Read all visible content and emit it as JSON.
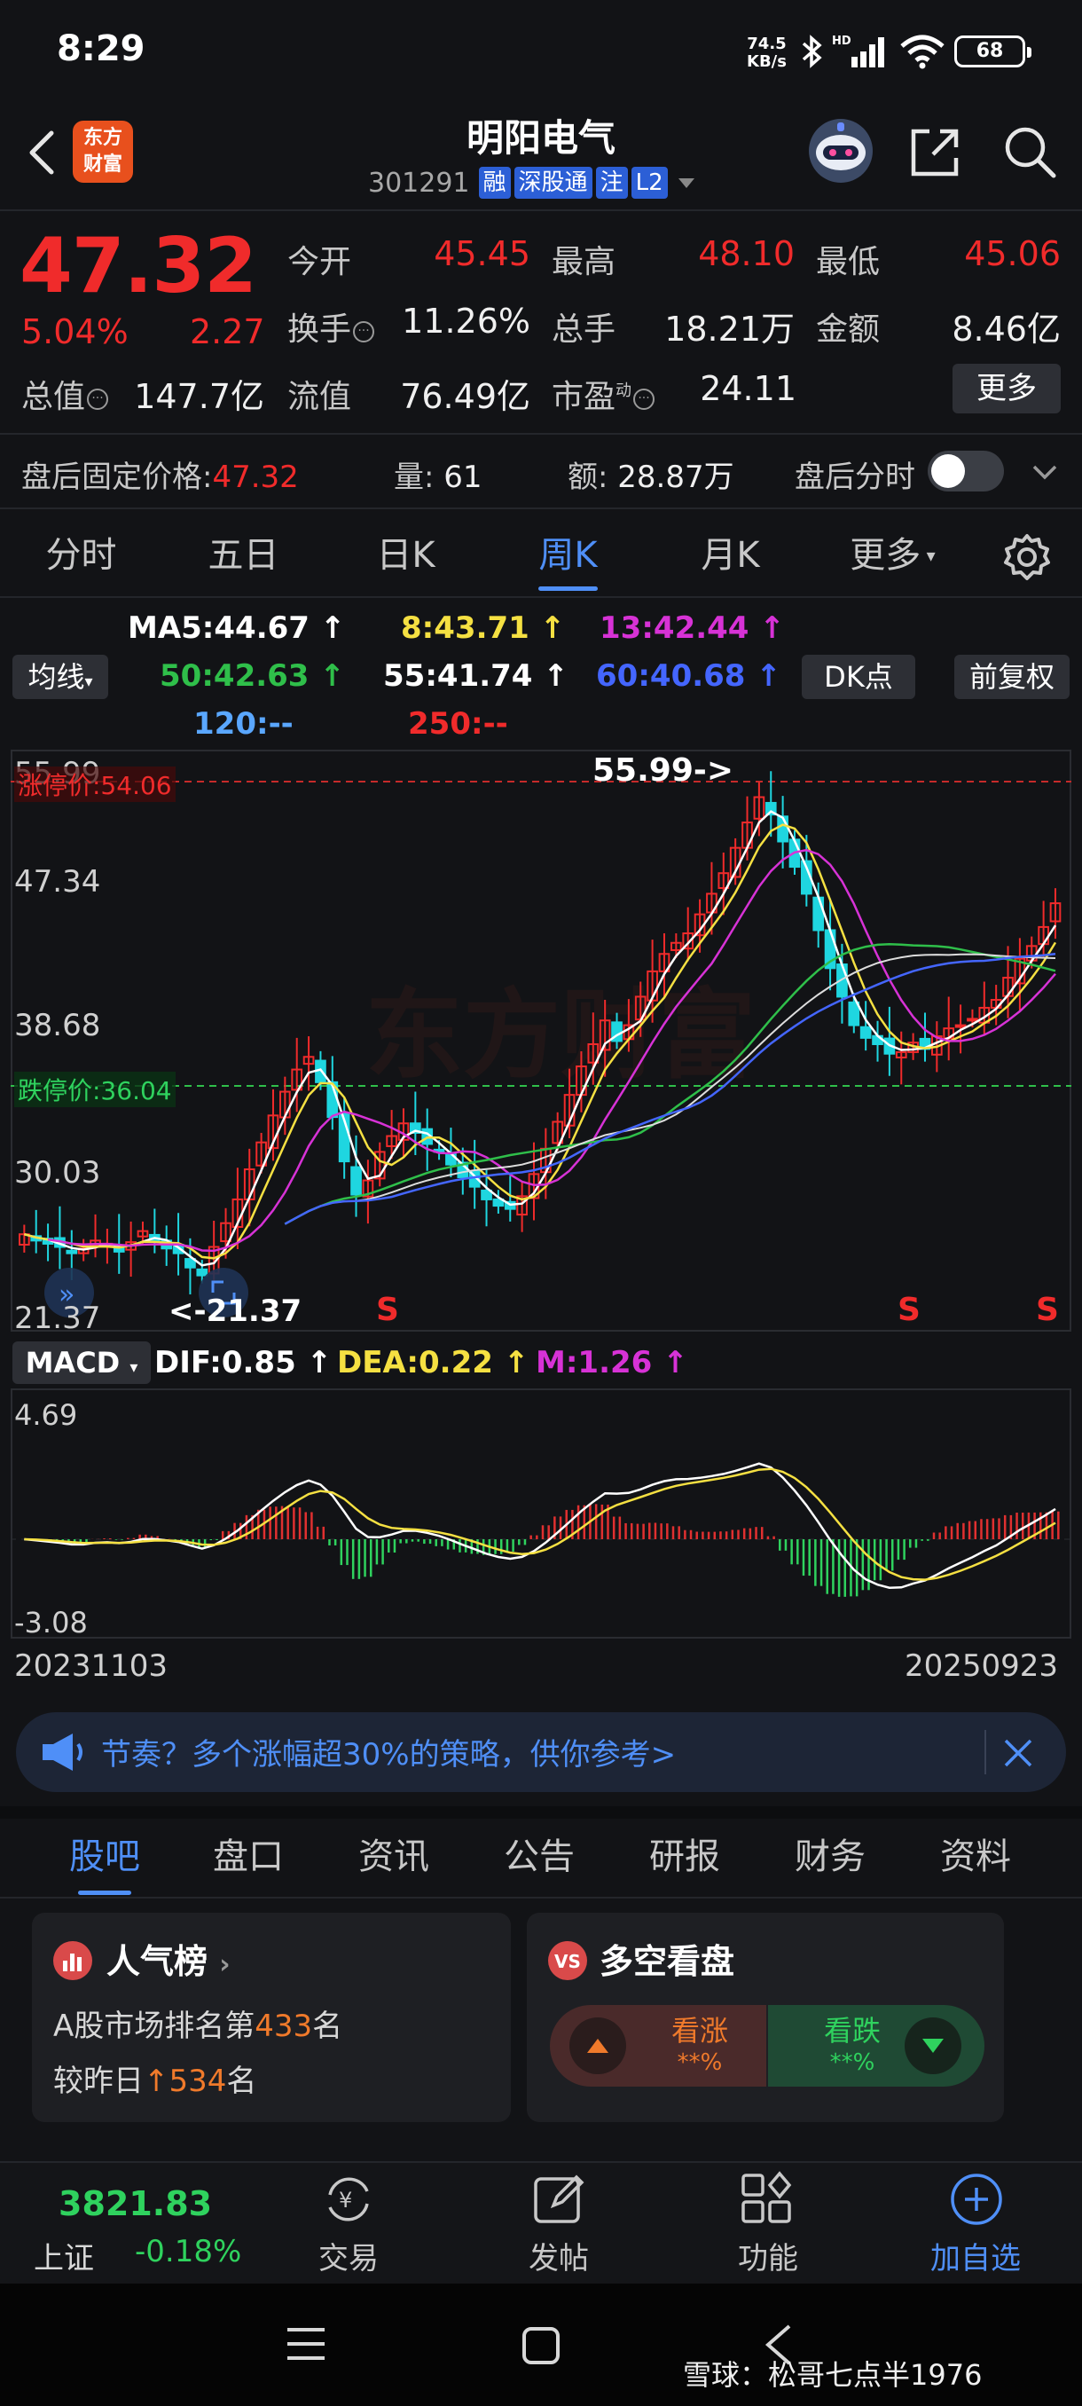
{
  "status": {
    "time": "8:29",
    "net_speed": "74.5",
    "net_unit": "KB/s",
    "battery": "68"
  },
  "header": {
    "logo_line1": "东方",
    "logo_line2": "财富",
    "stock_name": "明阳电气",
    "stock_code": "301291",
    "tags": [
      "融",
      "深股通",
      "注",
      "L2"
    ]
  },
  "quote": {
    "price": "47.32",
    "change_pct": "5.04%",
    "change_amt": "2.27",
    "open_label": "今开",
    "open": "45.45",
    "high_label": "最高",
    "high": "48.10",
    "low_label": "最低",
    "low": "45.06",
    "turnover_label": "换手",
    "turnover": "11.26%",
    "volume_label": "总手",
    "volume": "18.21万",
    "amount_label": "金额",
    "amount": "8.46亿",
    "mktcap_label": "总值",
    "mktcap": "147.7亿",
    "float_label": "流值",
    "float": "76.49亿",
    "pe_label": "市盈",
    "pe_sup": "动",
    "pe": "24.11",
    "more": "更多"
  },
  "afterhours": {
    "price_label": "盘后固定价格:",
    "price": "47.32",
    "vol_label": "量:",
    "vol": "61",
    "amt_label": "额:",
    "amt": "28.87万",
    "toggle_label": "盘后分时"
  },
  "period_tabs": [
    "分时",
    "五日",
    "日K",
    "周K",
    "月K",
    "更多"
  ],
  "ma_legend": {
    "ma5": "MA5:44.67",
    "ma8": "8:43.71",
    "ma13": "13:42.44",
    "ma50": "50:42.63",
    "ma55": "55:41.74",
    "ma60": "60:40.68",
    "ma120": "120:--",
    "ma250": "250:--",
    "avg_btn": "均线",
    "dk_btn": "DK点",
    "fq_btn": "前复权"
  },
  "chart_data": {
    "type": "candlestick",
    "y_ticks": [
      "55.99",
      "47.34",
      "38.68",
      "30.03",
      "21.37"
    ],
    "limit_up_label": "涨停价:54.06",
    "limit_down_label": "跌停价:36.04",
    "max_label": "55.99->",
    "min_label": "<-21.37",
    "sell_marks": [
      "S",
      "S",
      "S"
    ],
    "ylim": [
      21.37,
      55.99
    ],
    "closes": [
      26.4,
      26.0,
      25.8,
      25.6,
      25.2,
      25.5,
      26.0,
      25.8,
      25.3,
      25.9,
      26.6,
      26.0,
      25.5,
      25.2,
      24.3,
      23.8,
      25.6,
      27.1,
      28.6,
      30.5,
      32.2,
      33.9,
      35.4,
      36.8,
      37.6,
      36.0,
      33.8,
      31.0,
      28.9,
      29.8,
      31.6,
      32.6,
      33.4,
      32.8,
      32.1,
      31.6,
      30.8,
      30.0,
      29.4,
      28.6,
      28.2,
      28.0,
      28.8,
      30.2,
      31.8,
      33.5,
      35.2,
      37.0,
      38.4,
      39.9,
      38.6,
      39.6,
      41.4,
      43.0,
      44.1,
      44.8,
      45.4,
      46.6,
      47.9,
      49.2,
      50.8,
      52.4,
      54.0,
      52.9,
      51.2,
      49.6,
      47.9,
      45.6,
      43.2,
      41.4,
      39.6,
      38.8,
      38.4,
      37.8,
      37.9,
      38.5,
      38.1,
      38.9,
      39.4,
      39.6,
      40.0,
      40.7,
      41.2,
      42.6,
      43.8,
      44.6,
      45.8,
      47.3
    ],
    "macd_ticks": [
      "4.69",
      "-3.08"
    ],
    "dif": "DIF:0.85",
    "dea": "DEA:0.22",
    "m": "M:1.26",
    "macd_btn": "MACD",
    "start_date": "20231103",
    "end_date": "20250923"
  },
  "banner": {
    "text": "节奏？多个涨幅超30%的策略，供你参考>"
  },
  "info_tabs": [
    "股吧",
    "盘口",
    "资讯",
    "公告",
    "研报",
    "财务",
    "资料"
  ],
  "popularity": {
    "title": "人气榜",
    "rank_prefix": "A股市场排名第",
    "rank": "433",
    "rank_suffix": "名",
    "prev_prefix": "较昨日",
    "prev": "534",
    "prev_suffix": "名"
  },
  "sentiment": {
    "title": "多空看盘",
    "up": "看涨",
    "up_pct": "**%",
    "down": "看跌",
    "down_pct": "**%"
  },
  "bottom_bar": {
    "index_value": "3821.83",
    "index_name": "上证",
    "index_change": "-0.18%",
    "trade": "交易",
    "post": "发帖",
    "func": "功能",
    "add": "加自选"
  },
  "watermark": "雪球：松哥七点半1976"
}
